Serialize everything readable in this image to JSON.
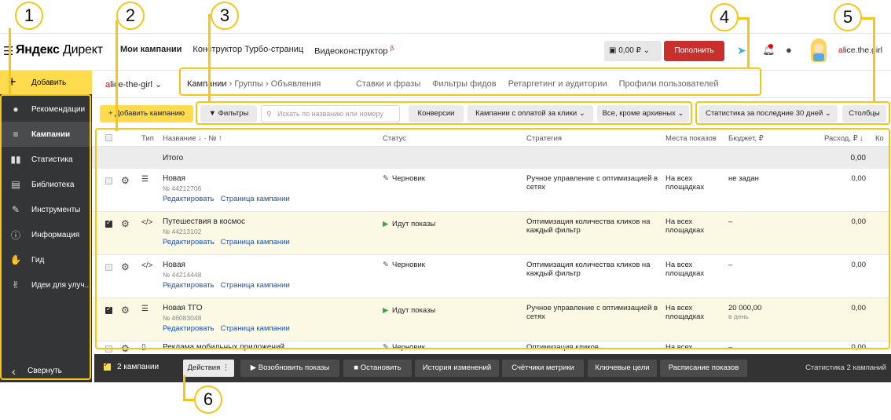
{
  "header": {
    "logo_yandex": "Яндекс",
    "logo_direct": "Директ",
    "nav": [
      {
        "label": "Мои кампании",
        "active": true
      },
      {
        "label": "Конструктор Турбо-страниц",
        "active": false
      },
      {
        "label": "Видеоконструктор",
        "active": false,
        "sup": "β"
      }
    ],
    "balance": "0,00 ₽",
    "topup_label": "Пополнить",
    "user_first": "a",
    "user_rest": "lice.the.girl"
  },
  "sidebar": {
    "add_label": "Добавить",
    "items": [
      {
        "label": "Рекомендации",
        "icon": "lightbulb-icon",
        "glyph": "💡"
      },
      {
        "label": "Кампании",
        "icon": "list-icon",
        "glyph": "≡",
        "active": true
      },
      {
        "label": "Статистика",
        "icon": "bar-chart-icon",
        "glyph": "▮"
      },
      {
        "label": "Библиотека",
        "icon": "library-icon",
        "glyph": "▤"
      },
      {
        "label": "Инструменты",
        "icon": "wrench-icon",
        "glyph": "🔧"
      },
      {
        "label": "Информация",
        "icon": "info-icon",
        "glyph": "ℹ"
      },
      {
        "label": "Гид",
        "icon": "guide-icon",
        "glyph": "👍"
      },
      {
        "label": "Идеи для улуч...",
        "icon": "thumbs-up-icon",
        "glyph": "👍"
      }
    ],
    "collapse_label": "Свернуть"
  },
  "subheader": {
    "account_first": "a",
    "account_rest": "lice-the-girl",
    "crumbs": [
      "Кампании",
      "Группы",
      "Объявления"
    ],
    "tabs": [
      "Ставки и фразы",
      "Фильтры фидов",
      "Ретаргетинг и аудитории",
      "Профили пользователей"
    ]
  },
  "toolbar": {
    "add_campaign": "+ Добавить кампанию",
    "filters": "Фильтры",
    "search_placeholder": "Искать по названию или номеру",
    "conversions": "Конверсии",
    "payment": "Кампании с оплатой за клики",
    "archive": "Все, кроме архивных",
    "stat_period": "Статистика за последние 30 дней",
    "columns": "Столбцы"
  },
  "table": {
    "headers": {
      "type": "Тип",
      "name": "Название ↓ · № ↑",
      "status": "Статус",
      "strategy": "Стратегия",
      "places": "Места показов",
      "budget": "Бюджет, ₽",
      "spend": "Расход, ₽ ↓",
      "more": "Ко"
    },
    "totals": {
      "label": "Итого",
      "spend": "0,00"
    },
    "edit_link": "Редактировать",
    "page_link": "Страница кампании",
    "rows": [
      {
        "checked": false,
        "type": "text",
        "name": "Новая",
        "number": "№ 44212706",
        "status": "Черновик",
        "playing": false,
        "strategy": "Ручное управление с оптимизацией в сетях",
        "places": "На всех площадках",
        "budget": "не задан",
        "budget_sub": "",
        "spend": "0,00"
      },
      {
        "checked": true,
        "type": "code",
        "name": "Путешествия в космос",
        "number": "№ 44213102",
        "status": "Идут показы",
        "playing": true,
        "strategy": "Оптимизация количества кликов на каждый фильтр",
        "places": "На всех площадках",
        "budget": "–",
        "budget_sub": "",
        "spend": "0,00"
      },
      {
        "checked": false,
        "type": "code",
        "name": "Новая",
        "number": "№ 44214448",
        "status": "Черновик",
        "playing": false,
        "strategy": "Оптимизация количества кликов на каждый фильтр",
        "places": "На всех площадках",
        "budget": "–",
        "budget_sub": "",
        "spend": "0,00"
      },
      {
        "checked": true,
        "type": "text",
        "name": "Новая ТГО",
        "number": "№ 46083048",
        "status": "Идут показы",
        "playing": true,
        "strategy": "Ручное управление с оптимизацией в сетях",
        "places": "На всех площадках",
        "budget": "20 000,00",
        "budget_sub": "в день",
        "spend": "0,00"
      },
      {
        "checked": false,
        "type": "text",
        "name": "Реклама мобильных приложений",
        "number": "",
        "status": "Черновик",
        "playing": false,
        "strategy": "Оптимизация кликов",
        "places": "На всех",
        "budget": "–",
        "budget_sub": "",
        "spend": "0,00"
      }
    ]
  },
  "actionbar": {
    "selected": "2 кампании",
    "buttons": [
      "Действия ⋮",
      "▶  Возобновить показы",
      "■  Остановить",
      "История изменений",
      "Счётчики метрики",
      "Ключевые цели",
      "Расписание показов"
    ],
    "stat": "Статистика 2 кампаний"
  },
  "annotations": [
    "1",
    "2",
    "3",
    "4",
    "5",
    "6"
  ],
  "colors": {
    "accent": "#ffdb4d",
    "highlight": "#f5c518",
    "topup": "#c8302e",
    "sidebar": "#343536",
    "link": "#1a52b3"
  }
}
